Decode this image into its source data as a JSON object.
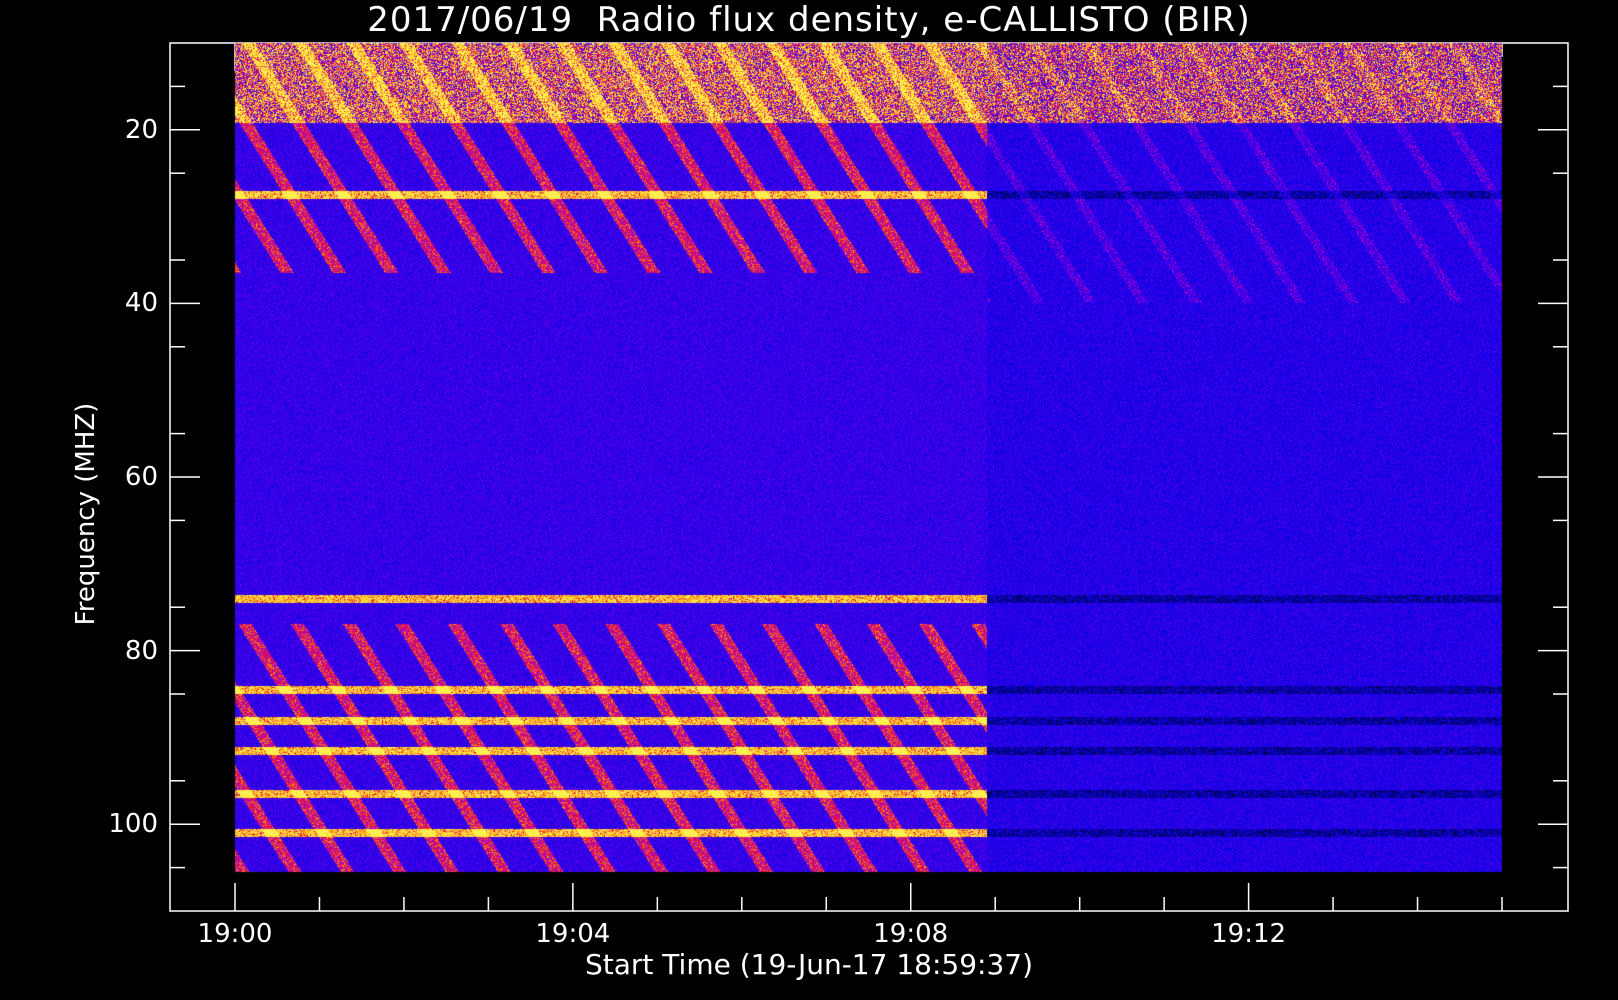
{
  "chart_data": {
    "type": "heatmap",
    "title": "2017/06/19  Radio flux density, e-CALLISTO (BIR)",
    "xlabel": "Start Time (19-Jun-17 18:59:37)",
    "ylabel": "Frequency (MHZ)",
    "x_tick_labels": [
      "19:00",
      "19:04",
      "19:08",
      "19:12"
    ],
    "x_range_minutes": [
      0,
      15
    ],
    "y_tick_labels": [
      "20",
      "40",
      "60",
      "80",
      "100"
    ],
    "y_ticks": [
      20,
      40,
      60,
      80,
      100
    ],
    "y_range": [
      10,
      110
    ],
    "y_inverted": true,
    "data_freq_range": [
      10,
      105.5
    ],
    "colormap": [
      "#000000",
      "#0000ff",
      "#cc2200",
      "#ffaa00",
      "#ffffaa"
    ],
    "features": [
      {
        "label": "interference band",
        "freq": 27.5
      },
      {
        "label": "interference band",
        "freq": 74
      },
      {
        "label": "interference band",
        "freq": 84.5
      },
      {
        "label": "interference band",
        "freq": 88
      },
      {
        "label": "interference band",
        "freq": 91.5
      },
      {
        "label": "interference band",
        "freq": 96.5
      },
      {
        "label": "interference band",
        "freq": 101
      }
    ],
    "calibration_change_minute": 8.9,
    "grid": false
  }
}
